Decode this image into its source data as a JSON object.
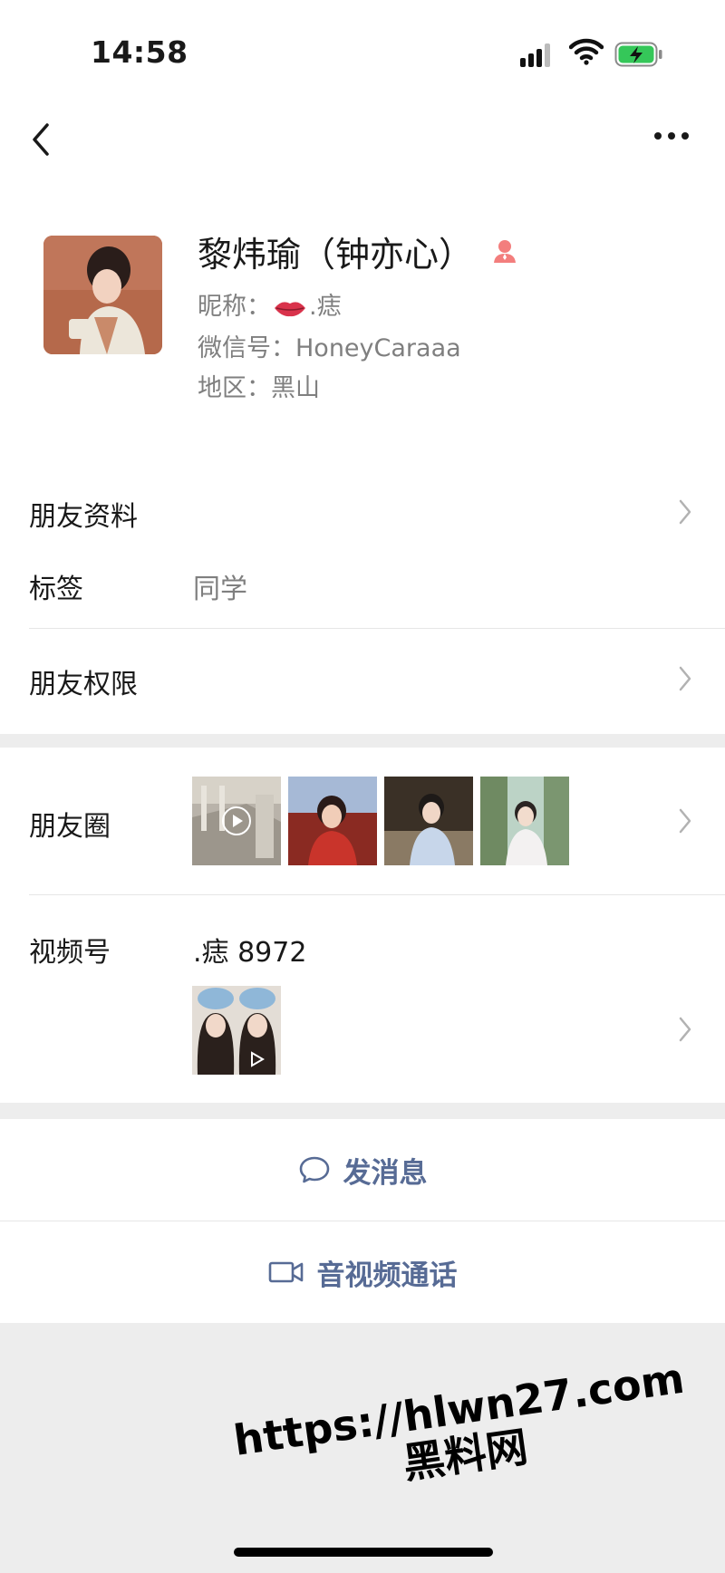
{
  "status_bar": {
    "time": "14:58"
  },
  "nav": {
    "back_icon": "chevron-left-icon",
    "more_icon": "more-dots-icon"
  },
  "profile": {
    "name": "黎炜瑜（钟亦心）",
    "gender_icon": "female-user-icon",
    "nickname_label": "昵称：",
    "nickname_suffix": ".痣",
    "wechat_id_line": "微信号：HoneyCaraaa",
    "region_line": "地区：黑山"
  },
  "rows": {
    "friend_info": "朋友资料",
    "tags_label": "标签",
    "tags_value": "同学",
    "permissions": "朋友权限",
    "moments": "朋友圈",
    "channels_label": "视频号",
    "channels_value": ".痣 8972"
  },
  "actions": {
    "message": "发消息",
    "av_call": "音视频通话"
  },
  "watermark": {
    "line1": "https://hlwn27.com",
    "line2": "黑料网"
  },
  "colors": {
    "link_blue": "#576b95",
    "gender_pink": "#f37e7d",
    "battery_green": "#35c759"
  }
}
